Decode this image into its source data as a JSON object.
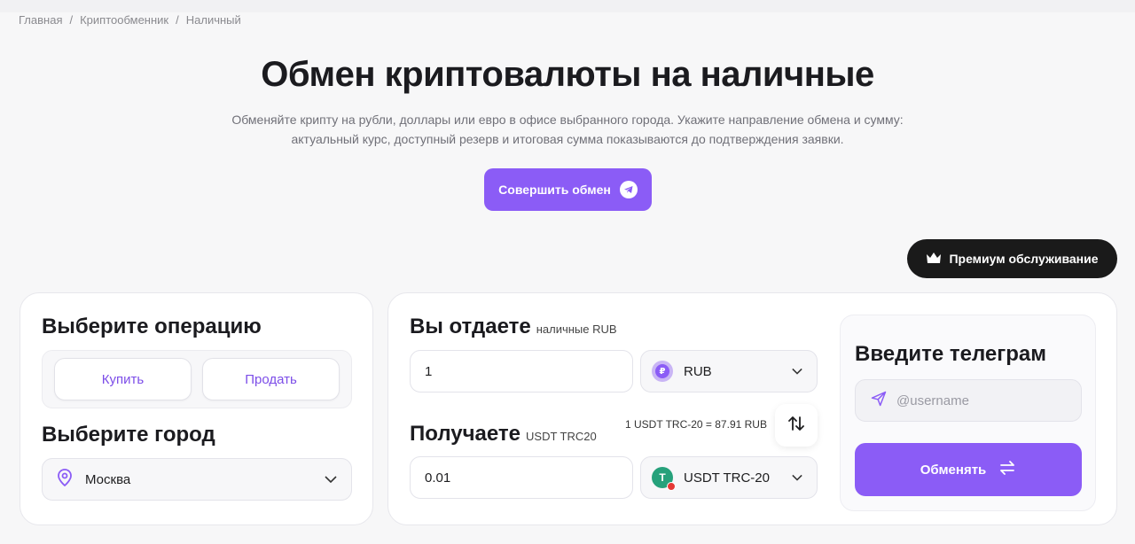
{
  "breadcrumb": [
    "Главная",
    "Криптообменник",
    "Наличный"
  ],
  "hero": {
    "title": "Обмен криптовалюты на наличные",
    "description": "Обменяйте крипту на рубли, доллары или евро в офисе выбранного города. Укажите направление обмена и сумму: актуальный курс, доступный резерв и итоговая сумма показываются до подтверждения заявки.",
    "cta_label": "Совершить обмен"
  },
  "premium_label": "Премиум обслуживание",
  "operation": {
    "title": "Выберите операцию",
    "buy_label": "Купить",
    "sell_label": "Продать"
  },
  "city": {
    "title": "Выберите город",
    "value": "Москва"
  },
  "give": {
    "title": "Вы отдаете",
    "subtitle": "наличные RUB",
    "amount": "1",
    "currency": "RUB",
    "currency_icon": "ruble-coin-icon"
  },
  "receive": {
    "title": "Получаете",
    "subtitle": "USDT TRC20",
    "amount": "0.01",
    "currency": "USDT TRC-20",
    "currency_icon": "tether-coin-icon"
  },
  "rate_text": "1 USDT TRC-20 = 87.91 RUB",
  "telegram": {
    "title": "Введите телеграм",
    "placeholder": "@username",
    "submit_label": "Обменять"
  },
  "colors": {
    "accent": "#8b5cf6",
    "premium_bg": "#1a1a1a",
    "tether": "#26a17b"
  }
}
